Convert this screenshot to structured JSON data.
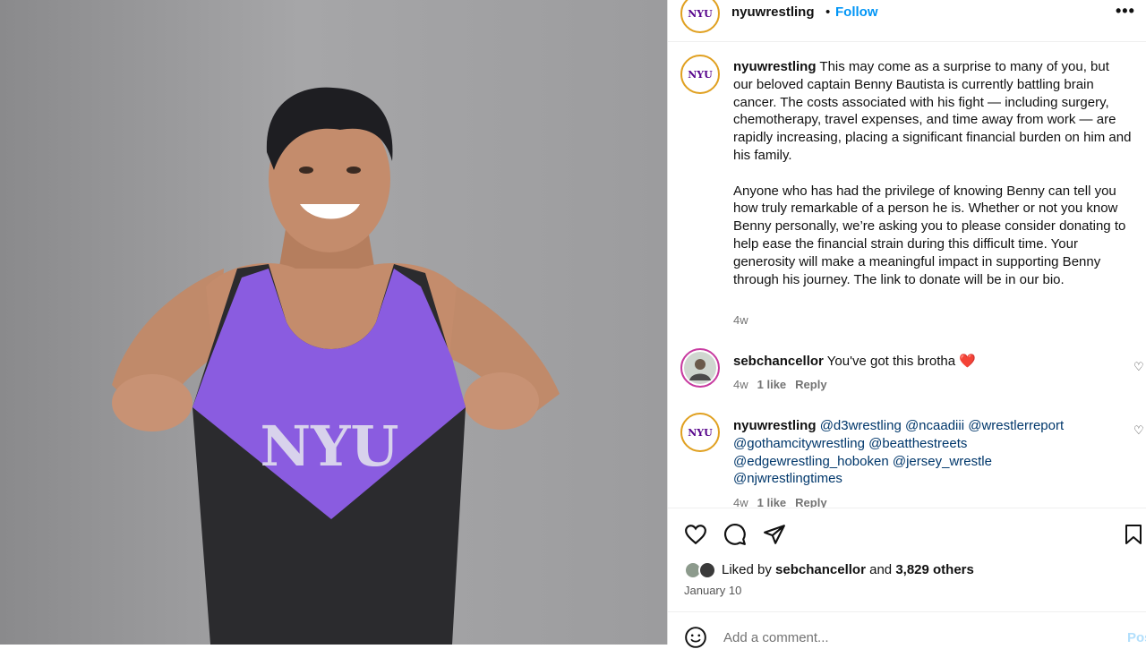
{
  "post": {
    "username": "nyuwrestling",
    "follow_label": "Follow",
    "more_label": "•••",
    "logo_text": "NYU"
  },
  "photo": {
    "jersey_text": "NYU",
    "jersey_color": "#8a5ce0",
    "description": "wrestler in NYU singlet"
  },
  "caption": {
    "username": "nyuwrestling",
    "paragraph1": "This may come as a surprise to many of you, but our beloved captain Benny Bautista is currently battling brain cancer. The costs associated with his fight — including surgery, chemotherapy, travel expenses, and time away from work — are rapidly increasing, placing a significant financial burden on him and his family.",
    "paragraph2": "Anyone who has had the privilege of knowing Benny can tell you how truly remarkable of a person he is. Whether or not you know Benny personally, we’re asking you to please consider donating to help ease the financial strain during this difficult time. Your generosity will make a meaningful impact in supporting Benny through his journey. The link to donate will be in our bio.",
    "time": "4w"
  },
  "comments": [
    {
      "username": "sebchancellor",
      "text": "You've got this brotha ❤️",
      "time": "4w",
      "likes": "1 like",
      "reply": "Reply"
    },
    {
      "username": "nyuwrestling",
      "text": "@d3wrestling @ncaadiii @wrestlerreport @gothamcitywrestling @beatthestreets @edgewrestling_hoboken @jersey_wrestle @njwrestlingtimes",
      "time": "4w",
      "likes": "1 like",
      "reply": "Reply"
    }
  ],
  "actions": {
    "liked_prefix": "Liked by",
    "liked_user": "sebchancellor",
    "liked_and": "and",
    "liked_others": "3,829 others",
    "date": "January 10"
  },
  "add_comment": {
    "placeholder": "Add a comment...",
    "post_label": "Post"
  },
  "colors": {
    "follow_blue": "#0095f6",
    "nyu_purple": "#57068c",
    "heart_red": "#ed4956"
  }
}
